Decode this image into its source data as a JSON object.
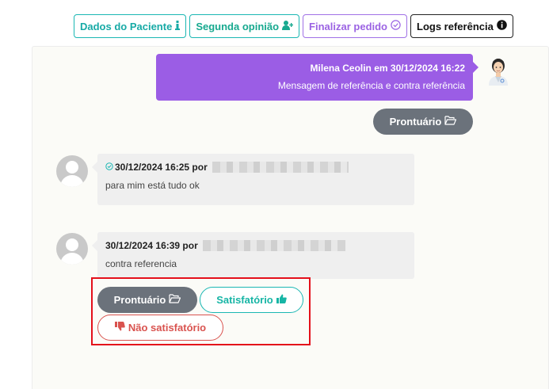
{
  "toolbar": {
    "patient_data_label": "Dados do Paciente",
    "second_opinion_label": "Segunda opinião",
    "finish_order_label": "Finalizar pedido",
    "reference_logs_label": "Logs referência"
  },
  "chat": {
    "sent_message": {
      "author_line": "Milena Ceolin em 30/12/2024 16:22",
      "text": "Mensagem de referência e contra referência"
    },
    "prontuario_label": "Prontuário",
    "messages": [
      {
        "meta": "30/12/2024 16:25 por",
        "text": "para mim está tudo ok"
      },
      {
        "meta": "30/12/2024 16:39 por",
        "text": "contra referencia"
      }
    ]
  },
  "actions": {
    "prontuario_label": "Prontuário",
    "satisfied_label": "Satisfatório",
    "not_satisfied_label": "Não satisfatório"
  },
  "colors": {
    "teal": "#1bb7b3",
    "purple": "#9b5de5",
    "gray_pill": "#6b727b",
    "red": "#d9534f",
    "highlight": "#e4101b"
  }
}
